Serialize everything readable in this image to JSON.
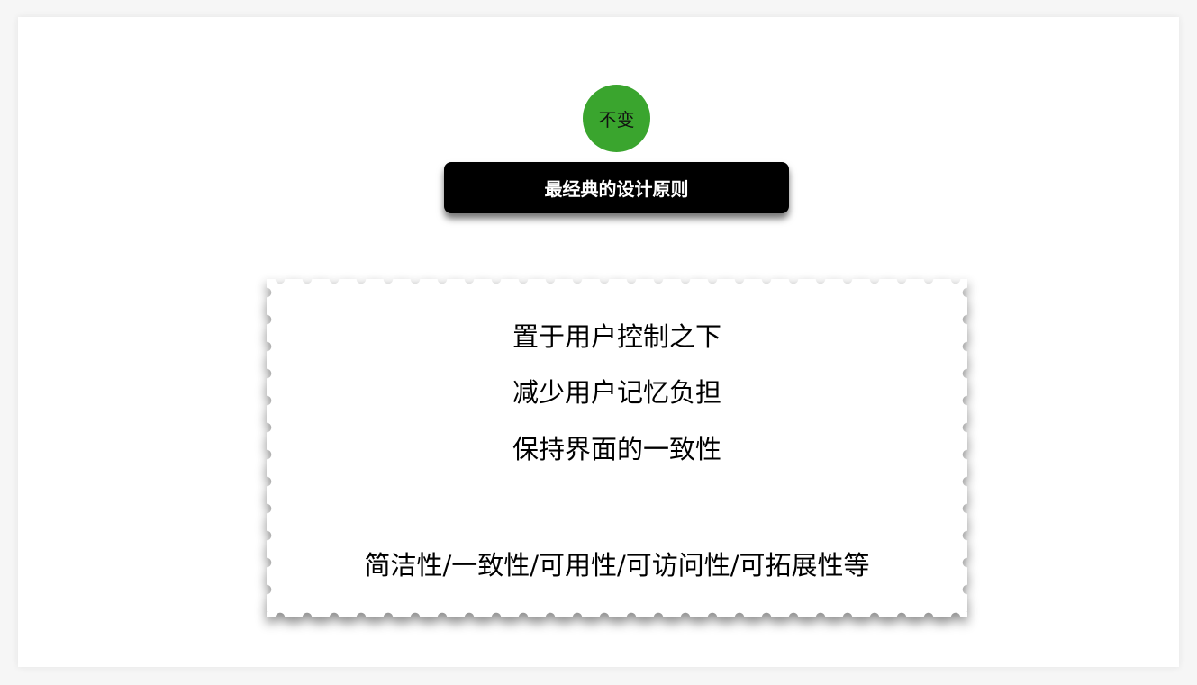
{
  "badge": {
    "label": "不变",
    "color": "#3aa52e"
  },
  "banner": {
    "title": "最经典的设计原则"
  },
  "principles": [
    "置于用户控制之下",
    "减少用户记忆负担",
    "保持界面的一致性"
  ],
  "summary": "简洁性/一致性/可用性/可访问性/可拓展性等"
}
